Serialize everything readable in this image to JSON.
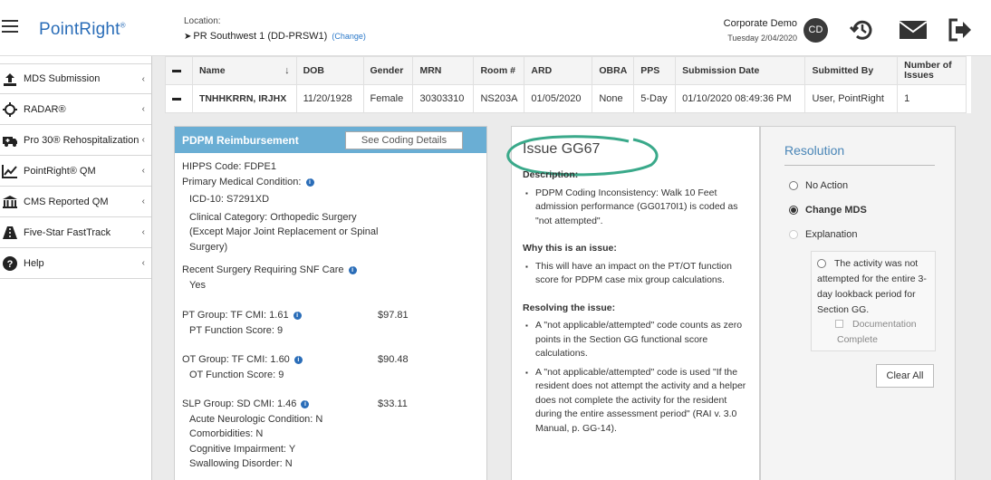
{
  "header": {
    "logo": "PointRight",
    "logo_mark": "®",
    "location_label": "Location:",
    "location_value": "PR Southwest 1 (DD-PRSW1)",
    "location_change": "(Change)",
    "user_name": "Corporate Demo",
    "date": "Tuesday 2/04/2020",
    "avatar_initials": "CD",
    "icons": [
      "history-icon",
      "mail-icon",
      "logout-icon"
    ]
  },
  "sidebar": {
    "items": [
      {
        "label": "MDS Submission",
        "icon": "upload-icon"
      },
      {
        "label": "RADAR®",
        "icon": "crosshair-icon"
      },
      {
        "label": "Pro 30® Rehospitalization",
        "icon": "ambulance-icon"
      },
      {
        "label": "PointRight® QM",
        "icon": "line-chart-icon"
      },
      {
        "label": "CMS Reported QM",
        "icon": "building-icon"
      },
      {
        "label": "Five-Star FastTrack",
        "icon": "road-icon"
      },
      {
        "label": "Help",
        "icon": "help-icon"
      }
    ]
  },
  "table": {
    "headers": {
      "name": "Name",
      "dob": "DOB",
      "gender": "Gender",
      "mrn": "MRN",
      "room": "Room #",
      "ard": "ARD",
      "obra": "OBRA",
      "pps": "PPS",
      "submission_date": "Submission Date",
      "submitted_by": "Submitted By",
      "num_issues": "Number of Issues"
    },
    "row": {
      "name": "TNHHKRRN, IRJHX",
      "dob": "11/20/1928",
      "gender": "Female",
      "mrn": "30303310",
      "room": "NS203A",
      "ard": "01/05/2020",
      "obra": "None",
      "pps": "5-Day",
      "submission_date": "01/10/2020 08:49:36 PM",
      "submitted_by": "User, PointRight",
      "num_issues": "1"
    }
  },
  "pdpm": {
    "title": "PDPM Reimbursement",
    "see_coding_button": "See Coding Details",
    "hipps": "HIPPS Code: FDPE1",
    "primary_condition_label": "Primary Medical Condition:",
    "icd10": "ICD-10: S7291XD",
    "clinical_category": "Clinical Category: Orthopedic Surgery (Except Major Joint Replacement or Spinal Surgery)",
    "recent_surgery_label": "Recent Surgery Requiring SNF Care",
    "recent_surgery_value": "Yes",
    "pt_group": "PT Group: TF CMI: 1.61",
    "pt_amount": "$97.81",
    "pt_function": "PT Function Score: 9",
    "ot_group": "OT Group: TF CMI: 1.60",
    "ot_amount": "$90.48",
    "ot_function": "OT Function Score: 9",
    "slp_group": "SLP Group: SD CMI: 1.46",
    "slp_amount": "$33.11",
    "slp_items": [
      "Acute Neurologic Condition: N",
      "Comorbidities: N",
      "Cognitive Impairment: Y",
      "Swallowing Disorder: N"
    ]
  },
  "issue": {
    "title": "Issue GG67",
    "description_label": "Description:",
    "description": "PDPM Coding Inconsistency: Walk 10 Feet admission performance (GG0170I1) is coded as \"not attempted\".",
    "why_label": "Why this is an issue:",
    "why": "This will have an impact on the PT/OT function score for PDPM case mix group calculations.",
    "resolving_label": "Resolving the issue:",
    "resolving": [
      "A \"not applicable/attempted\" code counts as zero points in the Section GG functional score calculations.",
      "A \"not applicable/attempted\" code is used \"If the resident does not attempt the activity and a helper does not complete the activity for the resident during the entire assessment period\" (RAI v. 3.0 Manual, p. GG-14)."
    ],
    "oval_color": "#3aa98a"
  },
  "resolution": {
    "title": "Resolution",
    "options": {
      "no_action": "No Action",
      "change_mds": "Change MDS",
      "explanation": "Explanation"
    },
    "selected": "change_mds",
    "sub_option": "The activity was not attempted for the entire 3-day lookback period for Section GG.",
    "checkbox_label": "Documentation Complete",
    "clear_button": "Clear All"
  },
  "colors": {
    "brand_blue": "#2a6db8",
    "panel_header": "#6aaed4",
    "link": "#2a78c9",
    "resolution_title": "#4a86b7"
  }
}
